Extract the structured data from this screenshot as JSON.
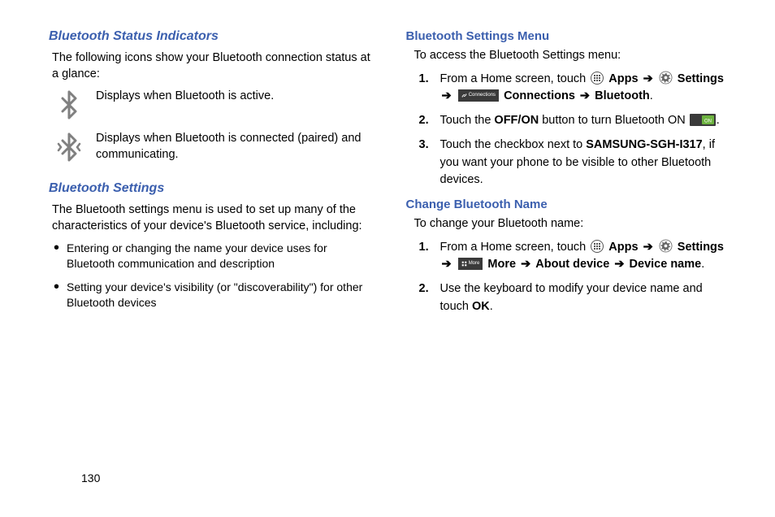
{
  "pageNumber": "130",
  "left": {
    "h1": "Bluetooth Status Indicators",
    "intro": "The following icons show your Bluetooth connection status at a glance:",
    "iconRows": [
      {
        "desc": "Displays when Bluetooth is active."
      },
      {
        "desc": "Displays when Bluetooth is connected (paired) and communicating."
      }
    ],
    "h2": "Bluetooth Settings",
    "settingsIntro": "The Bluetooth settings menu is used to set up many of the characteristics of your device's Bluetooth service, including:",
    "bullets": [
      "Entering or changing the name your device uses for Bluetooth communication and description",
      "Setting your device's visibility (or \"discoverability\") for other Bluetooth devices"
    ]
  },
  "right": {
    "h1": "Bluetooth Settings Menu",
    "intro1": "To access the Bluetooth Settings menu:",
    "step1": {
      "num": "1.",
      "pre": "From a Home screen, touch ",
      "apps": "Apps",
      "arrow1": "➔",
      "settings": "Settings",
      "arrow2": "➔",
      "connTab": "Connections",
      "connections": "Connections",
      "arrow3": "➔",
      "bluetooth": "Bluetooth",
      "period": "."
    },
    "step2": {
      "num": "2.",
      "t1": "Touch the ",
      "offon": "OFF/ON",
      "t2": " button to turn Bluetooth ON ",
      "period": "."
    },
    "step3": {
      "num": "3.",
      "t1": "Touch the checkbox next to ",
      "device": "SAMSUNG-SGH-I317",
      "t2": ", if you want your phone to be visible to other Bluetooth devices."
    },
    "h2": "Change Bluetooth Name",
    "intro2": "To change your Bluetooth name:",
    "cstep1": {
      "num": "1.",
      "pre": "From a Home screen, touch ",
      "apps": "Apps",
      "arrow1": "➔",
      "settings": "Settings",
      "arrow2": "➔",
      "moreTab": "More",
      "more": "More",
      "arrow3": "➔",
      "about": "About device",
      "arrow4": "➔",
      "dname": "Device name",
      "period": "."
    },
    "cstep2": {
      "num": "2.",
      "t1": "Use the keyboard to modify your device name and touch ",
      "ok": "OK",
      "period": "."
    }
  }
}
